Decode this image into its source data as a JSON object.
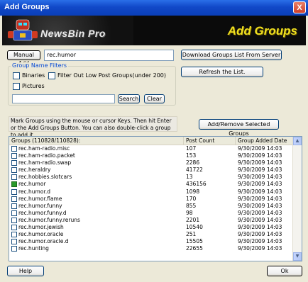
{
  "window": {
    "title": "Add Groups",
    "close_label": "X"
  },
  "banner": {
    "brand": "NewsBin Pro",
    "title": "Add Groups"
  },
  "manual_add": {
    "button_label": "Manual Add",
    "input_value": "rec.humor"
  },
  "download_button_label": "Download Groups List From Server",
  "refresh_button_label": "Refresh the List.",
  "filters": {
    "legend": "Group Name Filters",
    "binaries_label": "Binaries",
    "pictures_label": "Pictures",
    "low_post_label": "Filter Out Low Post Groups(under 200)",
    "search_value": "",
    "search_button_label": "Search",
    "clear_button_label": "Clear"
  },
  "info_text": "Mark Groups using the mouse or cursor Keys. Then hit Enter or the Add Groups Button. You can also double-click a group to add it.",
  "add_remove_button_label": "Add/Remove Selected Groups",
  "table": {
    "columns": [
      "Groups (110828/110828):",
      "Post Count",
      "Group Added Date"
    ],
    "rows": [
      {
        "name": "rec.ham-radio.misc",
        "count": "107",
        "date": "9/30/2009 14:03",
        "checked": false
      },
      {
        "name": "rec.ham-radio.packet",
        "count": "153",
        "date": "9/30/2009 14:03",
        "checked": false
      },
      {
        "name": "rec.ham-radio.swap",
        "count": "2286",
        "date": "9/30/2009 14:03",
        "checked": false
      },
      {
        "name": "rec.heraldry",
        "count": "41722",
        "date": "9/30/2009 14:03",
        "checked": false
      },
      {
        "name": "rec.hobbies.slotcars",
        "count": "13",
        "date": "9/30/2009 14:03",
        "checked": false
      },
      {
        "name": "rec.humor",
        "count": "436156",
        "date": "9/30/2009 14:03",
        "checked": true
      },
      {
        "name": "rec.humor.d",
        "count": "1098",
        "date": "9/30/2009 14:03",
        "checked": false
      },
      {
        "name": "rec.humor.flame",
        "count": "170",
        "date": "9/30/2009 14:03",
        "checked": false
      },
      {
        "name": "rec.humor.funny",
        "count": "855",
        "date": "9/30/2009 14:03",
        "checked": false
      },
      {
        "name": "rec.humor.funny.d",
        "count": "98",
        "date": "9/30/2009 14:03",
        "checked": false
      },
      {
        "name": "rec.humor.funny.reruns",
        "count": "2201",
        "date": "9/30/2009 14:03",
        "checked": false
      },
      {
        "name": "rec.humor.jewish",
        "count": "10540",
        "date": "9/30/2009 14:03",
        "checked": false
      },
      {
        "name": "rec.humor.oracle",
        "count": "251",
        "date": "9/30/2009 14:03",
        "checked": false
      },
      {
        "name": "rec.humor.oracle.d",
        "count": "15505",
        "date": "9/30/2009 14:03",
        "checked": false
      },
      {
        "name": "rec.hunting",
        "count": "22655",
        "date": "9/30/2009 14:03",
        "checked": false
      }
    ]
  },
  "help_button_label": "Help",
  "ok_button_label": "Ok"
}
